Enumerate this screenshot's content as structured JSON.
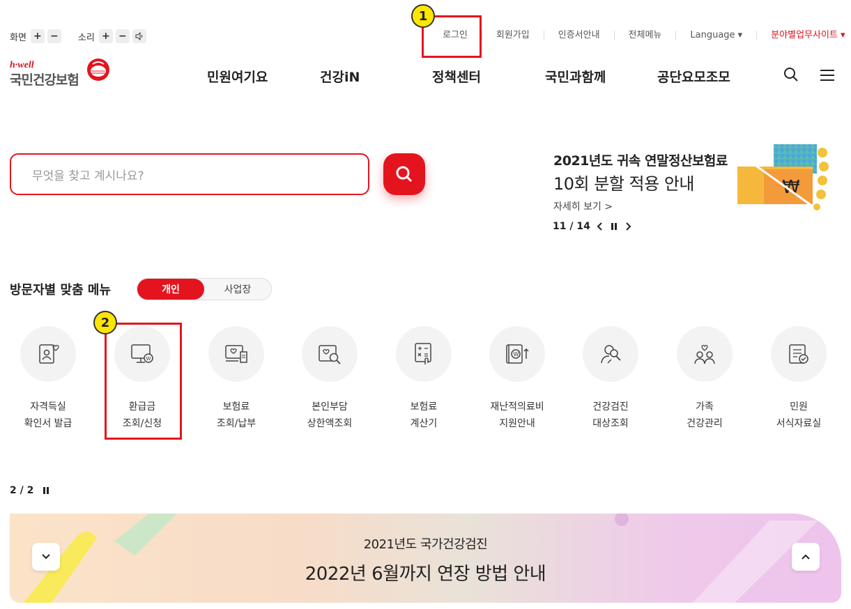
{
  "util": {
    "screen_label": "화면",
    "sound_label": "소리",
    "plus": "+",
    "minus": "−",
    "links": [
      "로그인",
      "회원가입",
      "인증서안내",
      "전체메뉴",
      "Language ▾",
      "분야별업무사이트 ▾"
    ]
  },
  "logo": {
    "small": "h·well",
    "name": "국민건강보험"
  },
  "gnb": [
    "민원여기요",
    "건강iN",
    "정책센터",
    "국민과함께",
    "공단요모조모"
  ],
  "search": {
    "placeholder": "무엇을 찾고 계시나요?"
  },
  "banner": {
    "title1": "2021년도 귀속 연말정산보험료",
    "title2": "10회 분할 적용 안내",
    "more": "자세히 보기 >",
    "current": "11",
    "total": "14"
  },
  "visitor_menu": {
    "title": "방문자별 맞춤 메뉴",
    "tab_personal": "개인",
    "tab_business": "사업장"
  },
  "services": [
    {
      "line1": "자격득실",
      "line2": "확인서 발급",
      "icon": "qualification-icon"
    },
    {
      "line1": "환급금",
      "line2": "조회/신청",
      "icon": "refund-monitor-icon"
    },
    {
      "line1": "보험료",
      "line2": "조회/납부",
      "icon": "premium-payment-icon"
    },
    {
      "line1": "본인부담",
      "line2": "상한액조회",
      "icon": "copay-search-icon"
    },
    {
      "line1": "보험료",
      "line2": "계산기",
      "icon": "calculator-icon"
    },
    {
      "line1": "재난적의료비",
      "line2": "지원안내",
      "icon": "disaster-medical-icon"
    },
    {
      "line1": "건강검진",
      "line2": "대상조회",
      "icon": "health-checkup-icon"
    },
    {
      "line1": "가족",
      "line2": "건강관리",
      "icon": "family-health-icon"
    },
    {
      "line1": "민원",
      "line2": "서식자료실",
      "icon": "forms-icon"
    }
  ],
  "pager2": {
    "current": "2",
    "total": "2"
  },
  "bottom_banner": {
    "title1": "2021년도 국가건강검진",
    "title2": "2022년 6월까지 연장 방법 안내"
  },
  "annotations": [
    "1",
    "2"
  ],
  "colors": {
    "accent": "#e4141e",
    "badge": "#ffe600"
  }
}
